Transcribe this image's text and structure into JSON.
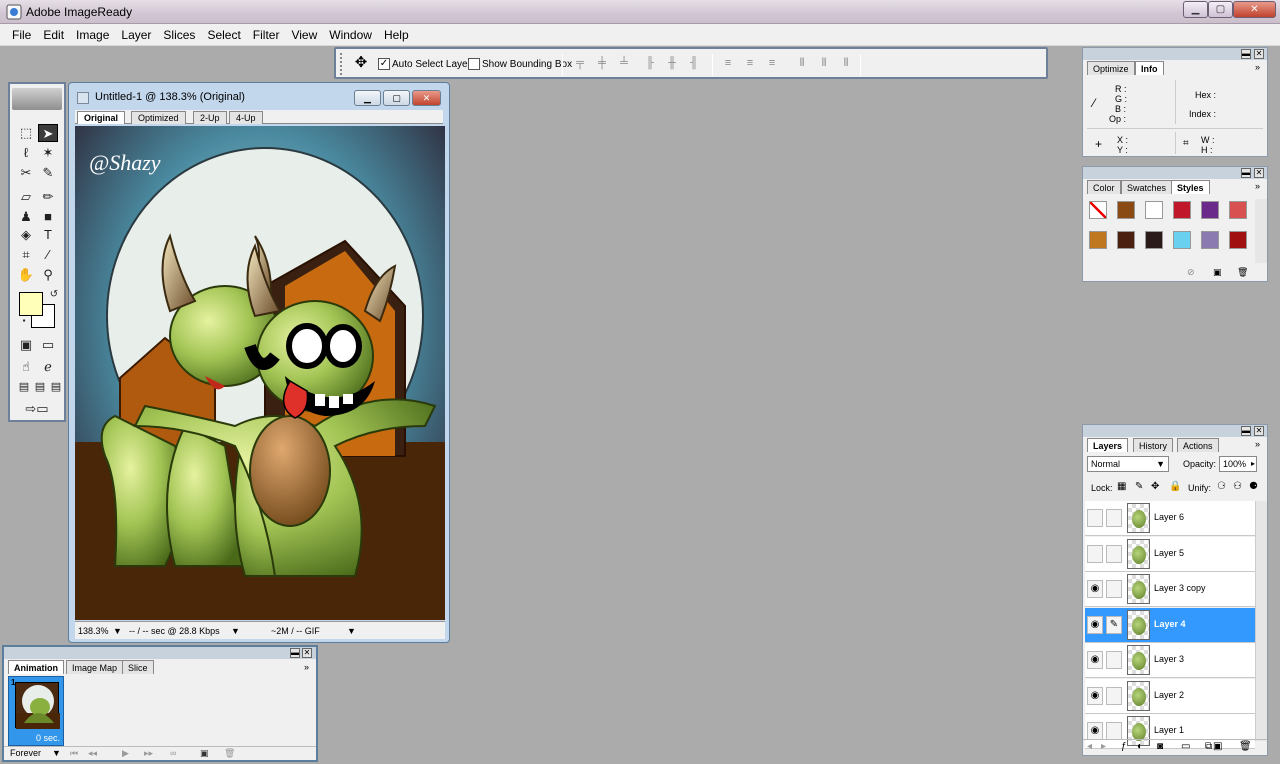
{
  "app": {
    "title": "Adobe ImageReady"
  },
  "menu": [
    "File",
    "Edit",
    "Image",
    "Layer",
    "Slices",
    "Select",
    "Filter",
    "View",
    "Window",
    "Help"
  ],
  "options": {
    "auto_select_label": "Auto Select Layer",
    "auto_select_checked": true,
    "bounding_box_label": "Show Bounding Box",
    "bounding_box_checked": false
  },
  "toolbox": {
    "fg_color": "#ffffb9",
    "bg_color": "#ffffff"
  },
  "document": {
    "title": "Untitled-1 @ 138.3% (Original)",
    "tabs": [
      "Original",
      "Optimized",
      "2-Up",
      "4-Up"
    ],
    "active_tab": "Original",
    "zoom": "138.3%",
    "download_time": "-- / -- sec @ 28.8 Kbps",
    "file_size": "~2M / -- GIF",
    "signature": "@Shazy"
  },
  "animation": {
    "tabs": [
      "Animation",
      "Image Map",
      "Slice"
    ],
    "frame_number": "1",
    "frame_delay": "0 sec.",
    "loop": "Forever"
  },
  "info": {
    "tabs": [
      "Optimize",
      "Info"
    ],
    "rgb_labels": [
      "R :",
      "G :",
      "B :",
      "Op :"
    ],
    "hex_label": "Hex :",
    "index_label": "Index :",
    "xy_labels": [
      "X :",
      "Y :"
    ],
    "wh_labels": [
      "W :",
      "H :"
    ]
  },
  "styles": {
    "tabs": [
      "Color",
      "Swatches",
      "Styles"
    ],
    "swatch_colors": [
      "#ffffff",
      "#8a4a14",
      "#ffffff",
      "#c0182a",
      "#6a2a8a",
      "#d85050",
      "#c07820",
      "#4a2010",
      "#2a1a1a",
      "#6ad0f0",
      "#8a7ab0",
      "#a01010"
    ]
  },
  "layers": {
    "tabs": [
      "Layers",
      "History",
      "Actions"
    ],
    "blend_mode": "Normal",
    "opacity_label": "Opacity:",
    "opacity": "100%",
    "lock_label": "Lock:",
    "unify_label": "Unify:",
    "items": [
      {
        "name": "Layer 6",
        "visible": false,
        "selected": false
      },
      {
        "name": "Layer 5",
        "visible": false,
        "selected": false
      },
      {
        "name": "Layer 3 copy",
        "visible": true,
        "selected": false
      },
      {
        "name": "Layer 4",
        "visible": true,
        "selected": true
      },
      {
        "name": "Layer 3",
        "visible": true,
        "selected": false
      },
      {
        "name": "Layer 2",
        "visible": true,
        "selected": false
      },
      {
        "name": "Layer 1",
        "visible": true,
        "selected": false
      }
    ]
  }
}
